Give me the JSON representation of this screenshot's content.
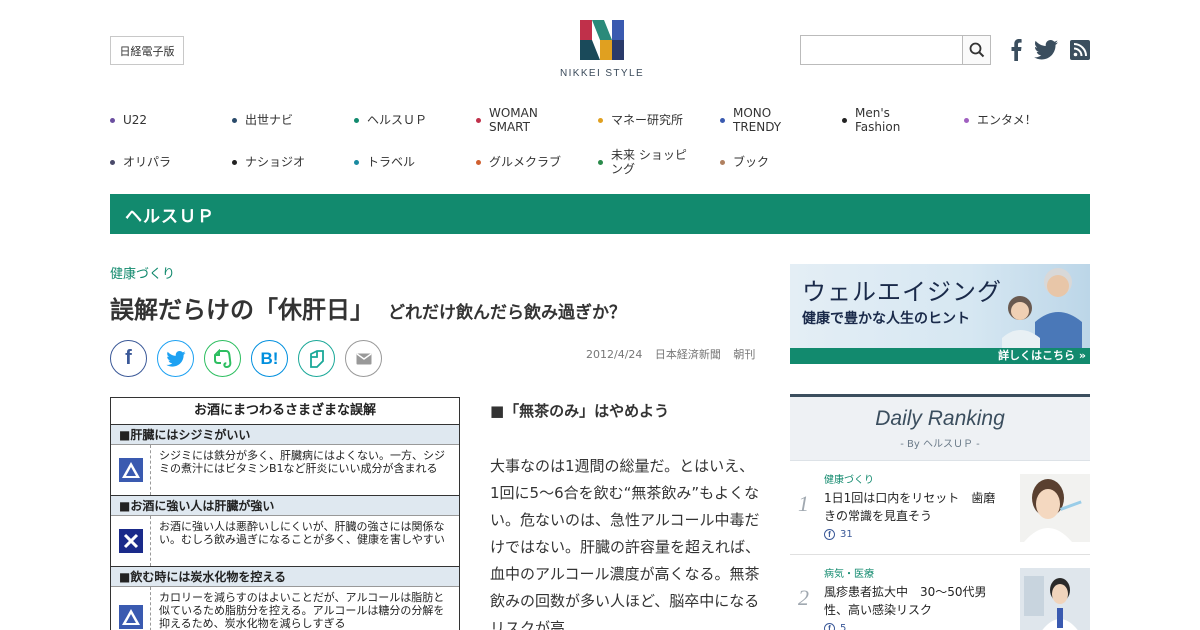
{
  "header": {
    "nikkei_button": "日経電子版",
    "logo_text": "NIKKEI STYLE",
    "search": {
      "placeholder": "",
      "value": ""
    },
    "social": [
      "facebook-icon",
      "twitter-icon",
      "rss-icon"
    ]
  },
  "nav": {
    "rows": [
      [
        {
          "label": "U22",
          "color": "#6b4fa0"
        },
        {
          "label": "出世ナビ",
          "color": "#2a4a6a"
        },
        {
          "label": "ヘルスＵＰ",
          "color": "#128a6e"
        },
        {
          "label": "WOMAN SMART",
          "color": "#c0304a"
        },
        {
          "label": "マネー研究所",
          "color": "#e0a020"
        },
        {
          "label": "MONO TRENDY",
          "color": "#3a5ab0"
        },
        {
          "label": "Men's Fashion",
          "color": "#222222"
        },
        {
          "label": "エンタメ！",
          "color": "#a060c0"
        }
      ],
      [
        {
          "label": "オリパラ",
          "color": "#4a4a6a"
        },
        {
          "label": "ナショジオ",
          "color": "#222222"
        },
        {
          "label": "トラベル",
          "color": "#1a8aa0"
        },
        {
          "label": "グルメクラブ",
          "color": "#d06030"
        },
        {
          "label": "未来 ショッピング",
          "color": "#2a8a4a"
        },
        {
          "label": "ブック",
          "color": "#b08060"
        }
      ]
    ]
  },
  "section": {
    "title": "ヘルスＵＰ",
    "color": "#128a6e"
  },
  "article": {
    "category": "健康づくり",
    "title": "誤解だらけの「休肝日」",
    "subtitle": "どれだけ飲んだら飲み過ぎか？",
    "date": "2012/4/24",
    "source": "日本経済新聞",
    "edition": "朝刊",
    "share": [
      {
        "name": "facebook",
        "glyph": "f",
        "color": "#3b5998"
      },
      {
        "name": "twitter",
        "glyph": "",
        "color": "#1da1f2"
      },
      {
        "name": "evernote",
        "glyph": "",
        "color": "#2dbe60"
      },
      {
        "name": "hatena",
        "glyph": "B!",
        "color": "#008fde"
      },
      {
        "name": "pocket",
        "glyph": "",
        "color": "#1aa898"
      },
      {
        "name": "mail",
        "glyph": "",
        "color": "#999999"
      }
    ],
    "table": {
      "title": "お酒にまつわるさまざまな誤解",
      "sections": [
        {
          "heading": "■肝臓にはシジミがいい",
          "mark": "triangle",
          "text": "シジミには鉄分が多く、肝臓病にはよくない。一方、シジミの煮汁にはビタミンB1など肝炎にいい成分が含まれる"
        },
        {
          "heading": "■お酒に強い人は肝臓が強い",
          "mark": "cross",
          "text": "お酒に強い人は悪酔いしにくいが、肝臓の強さには関係ない。むしろ飲み過ぎになることが多く、健康を害しやすい"
        },
        {
          "heading": "■飲む時には炭水化物を控える",
          "mark": "triangle",
          "text": "カロリーを減らすのはよいことだが、アルコールは脂肪と似ているため脂肪分を控える。アルコールは糖分の分解を抑えるため、炭水化物を減らしすぎる"
        }
      ]
    },
    "body_subhead": "■「無茶のみ」はやめよう",
    "body_text": "大事なのは1週間の総量だ。とはいえ、1回に5～6合を飲む“無茶飲み”もよくない。危ないのは、急性アルコール中毒だけではない。肝臓の許容量を超えれば、血中のアルコール濃度が高くなる。無茶飲みの回数が多い人ほど、脳卒中になるリスクが高"
  },
  "ad": {
    "title": "ウェルエイジング",
    "subtitle": "健康で豊かな人生のヒント",
    "link": "詳しくはこちら »"
  },
  "ranking": {
    "title": "Daily Ranking",
    "by": "- By ヘルスＵＰ -",
    "items": [
      {
        "rank": "1",
        "category": "健康づくり",
        "title": "1日1回は口内をリセット　歯磨きの常識を見直そう",
        "count": "31"
      },
      {
        "rank": "2",
        "category": "病気・医療",
        "title": "風疹患者拡大中　30～50代男性、高い感染リスク",
        "count": "5"
      }
    ]
  }
}
